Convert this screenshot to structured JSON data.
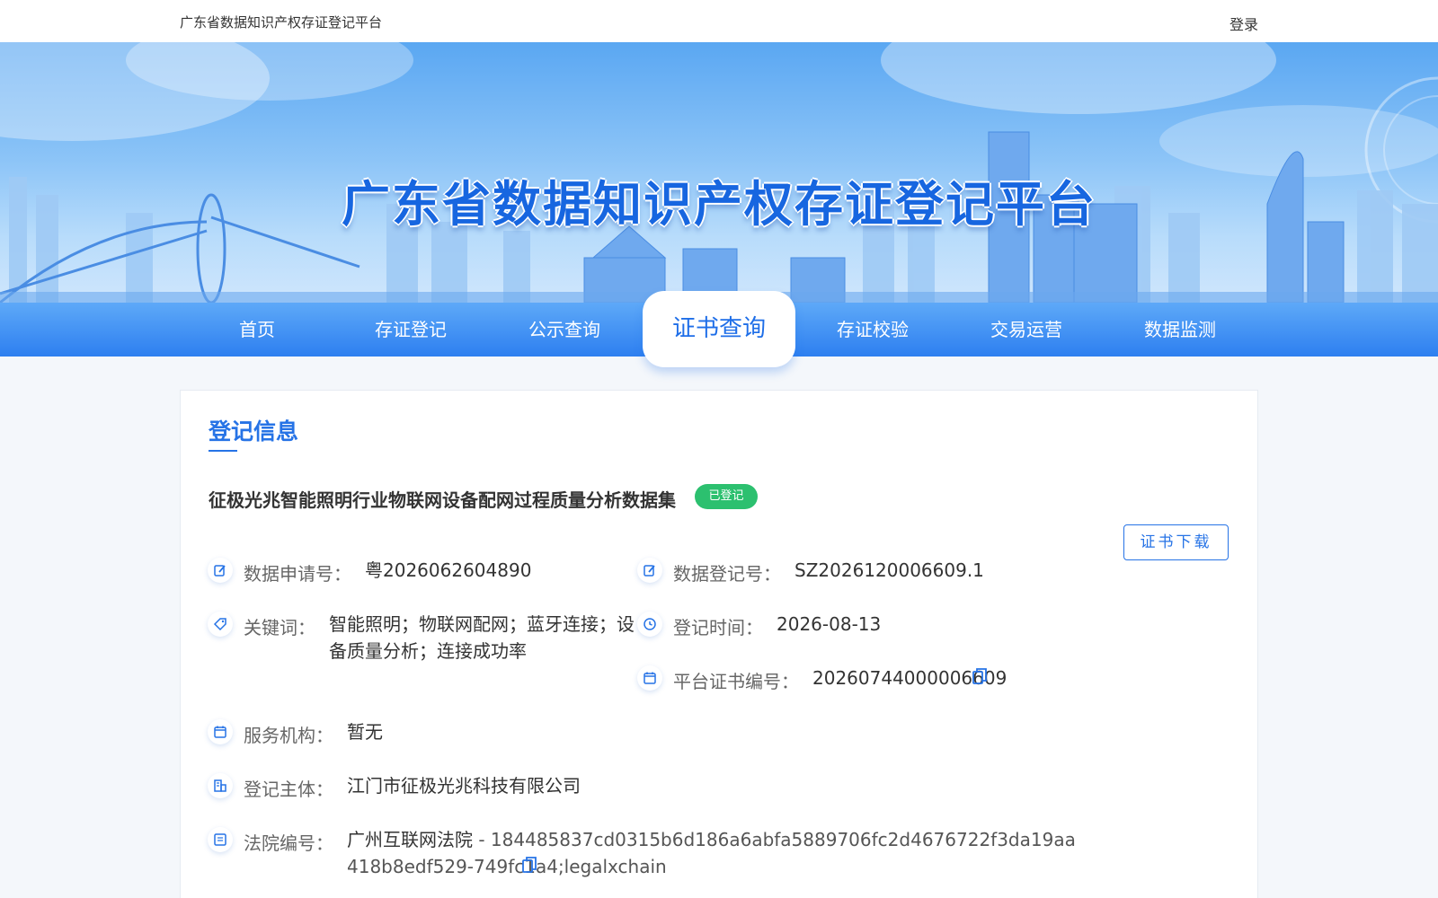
{
  "header": {
    "site_name": "广东省数据知识产权存证登记平台",
    "login_label": "登录"
  },
  "banner": {
    "title": "广东省数据知识产权存证登记平台"
  },
  "nav": {
    "items": [
      {
        "label": "首页"
      },
      {
        "label": "存证登记"
      },
      {
        "label": "公示查询"
      },
      {
        "label": "证书查询",
        "active": true
      },
      {
        "label": "存证校验"
      },
      {
        "label": "交易运营"
      },
      {
        "label": "数据监测"
      }
    ]
  },
  "card": {
    "section_title": "登记信息",
    "dataset_name": "征极光兆智能照明行业物联网设备配网过程质量分析数据集",
    "status": "已登记",
    "download_label": "证书下载",
    "fields": {
      "application_no": {
        "label": "数据申请号：",
        "value": "粤2026062604890",
        "icon": "edit-icon"
      },
      "registration_no": {
        "label": "数据登记号：",
        "value": "SZ2026120006609.1",
        "icon": "edit-icon"
      },
      "keywords": {
        "label": "关键词：",
        "value": "智能照明；物联网配网；蓝牙连接；设备质量分析；连接成功率",
        "icon": "tag-icon"
      },
      "registration_time": {
        "label": "登记时间：",
        "value": "2026-08-13",
        "icon": "clock-icon"
      },
      "platform_cert_no": {
        "label": "平台证书编号：",
        "value": "20260744000006609",
        "icon": "calendar-icon"
      },
      "service_org": {
        "label": "服务机构：",
        "value": "暂无",
        "icon": "calendar-icon"
      },
      "registrant": {
        "label": "登记主体：",
        "value": "江门市征极光兆科技有限公司",
        "icon": "building-icon"
      },
      "court_no": {
        "label": "法院编号：",
        "court": "广州互联网法院",
        "value": " - 184485837cd0315b6d186a6abfa5889706fc2d4676722f3da19aa418b8edf529-749fc1a4;legalxchain",
        "icon": "document-icon"
      }
    }
  },
  "colors": {
    "primary": "#2673e6",
    "success": "#2cc06f"
  }
}
